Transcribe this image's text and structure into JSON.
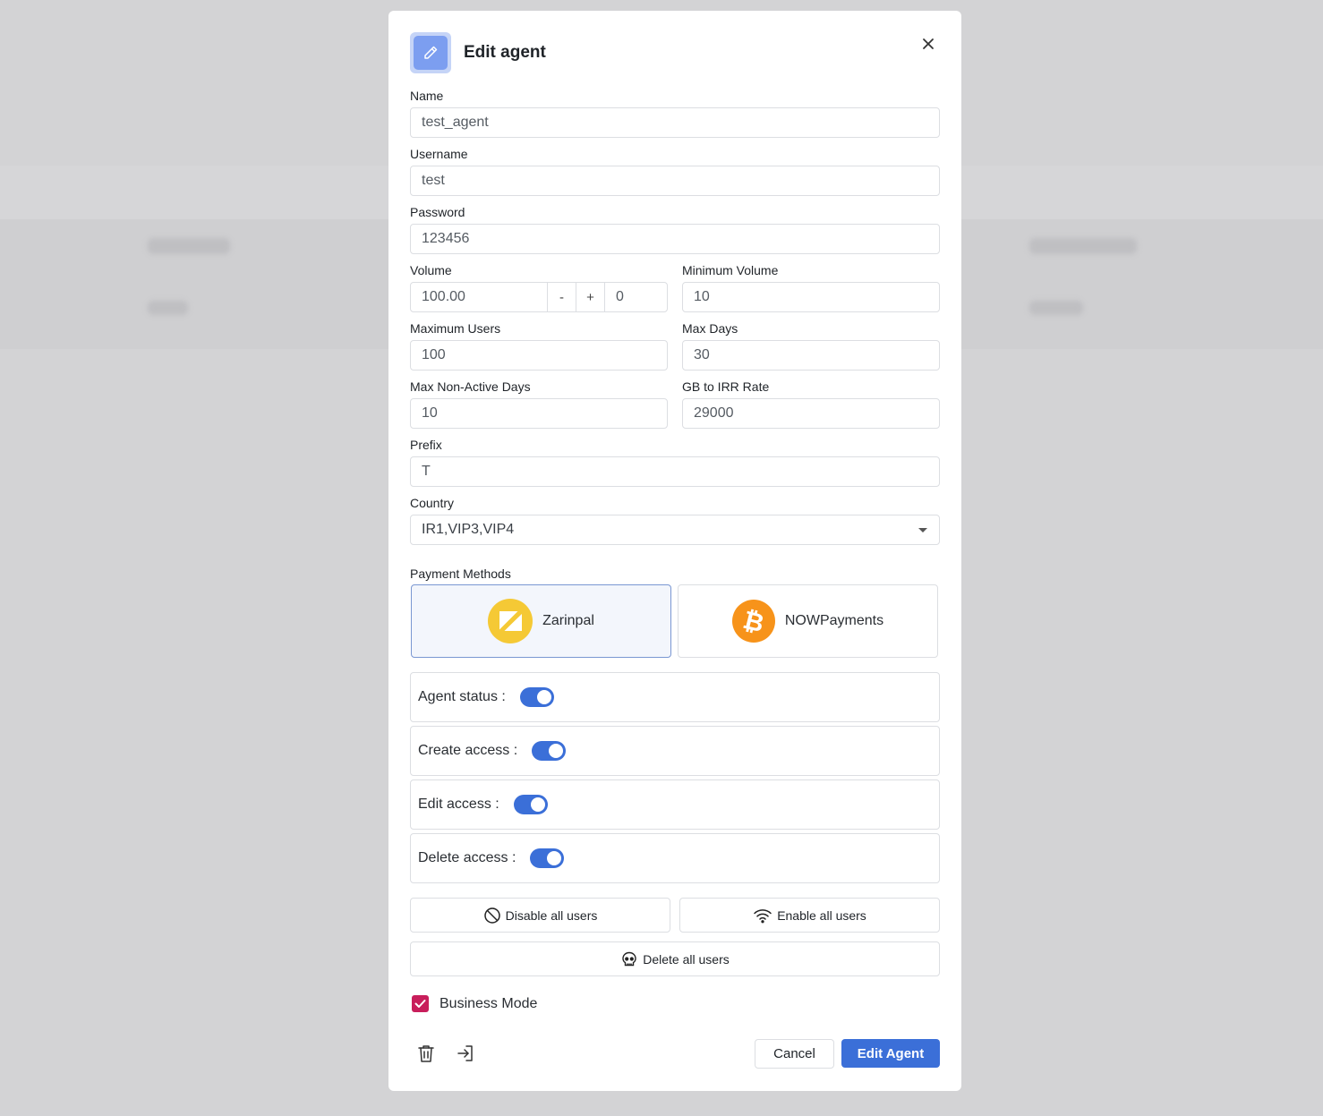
{
  "dialog": {
    "title": "Edit agent",
    "close_label": "×"
  },
  "fields": {
    "name": {
      "label": "Name",
      "value": "test_agent"
    },
    "username": {
      "label": "Username",
      "value": "test"
    },
    "password": {
      "label": "Password",
      "value": "123456"
    },
    "volume": {
      "label": "Volume",
      "value": "100.00",
      "minus": "-",
      "plus": "+",
      "step_value": "0"
    },
    "min_volume": {
      "label": "Minimum Volume",
      "value": "10"
    },
    "max_users": {
      "label": "Maximum Users",
      "value": "100"
    },
    "max_days": {
      "label": "Max Days",
      "value": "30"
    },
    "max_non_active_days": {
      "label": "Max Non-Active Days",
      "value": "10"
    },
    "gb_rate": {
      "label": "GB to IRR Rate",
      "value": "29000"
    },
    "prefix": {
      "label": "Prefix",
      "value": "T"
    },
    "country": {
      "label": "Country",
      "value": "IR1,VIP3,VIP4"
    }
  },
  "payment_methods": {
    "label": "Payment Methods",
    "items": [
      {
        "name": "Zarinpal",
        "selected": true,
        "icon": "zarinpal-logo",
        "color": "#f5c935"
      },
      {
        "name": "NOWPayments",
        "selected": false,
        "icon": "bitcoin-logo",
        "color": "#f7931a"
      }
    ]
  },
  "toggles": [
    {
      "label": "Agent status :",
      "on": true
    },
    {
      "label": "Create access :",
      "on": true
    },
    {
      "label": "Edit access :",
      "on": true
    },
    {
      "label": "Delete access :",
      "on": true
    }
  ],
  "actions": {
    "disable_all": "Disable all users",
    "enable_all": "Enable all users",
    "delete_all": "Delete all users"
  },
  "business_mode": {
    "label": "Business Mode",
    "checked": true
  },
  "footer": {
    "cancel": "Cancel",
    "submit": "Edit Agent"
  },
  "colors": {
    "primary": "#3b6fd8",
    "checkbox": "#c81e5b",
    "header_icon_bg": "#7c9ef0"
  }
}
